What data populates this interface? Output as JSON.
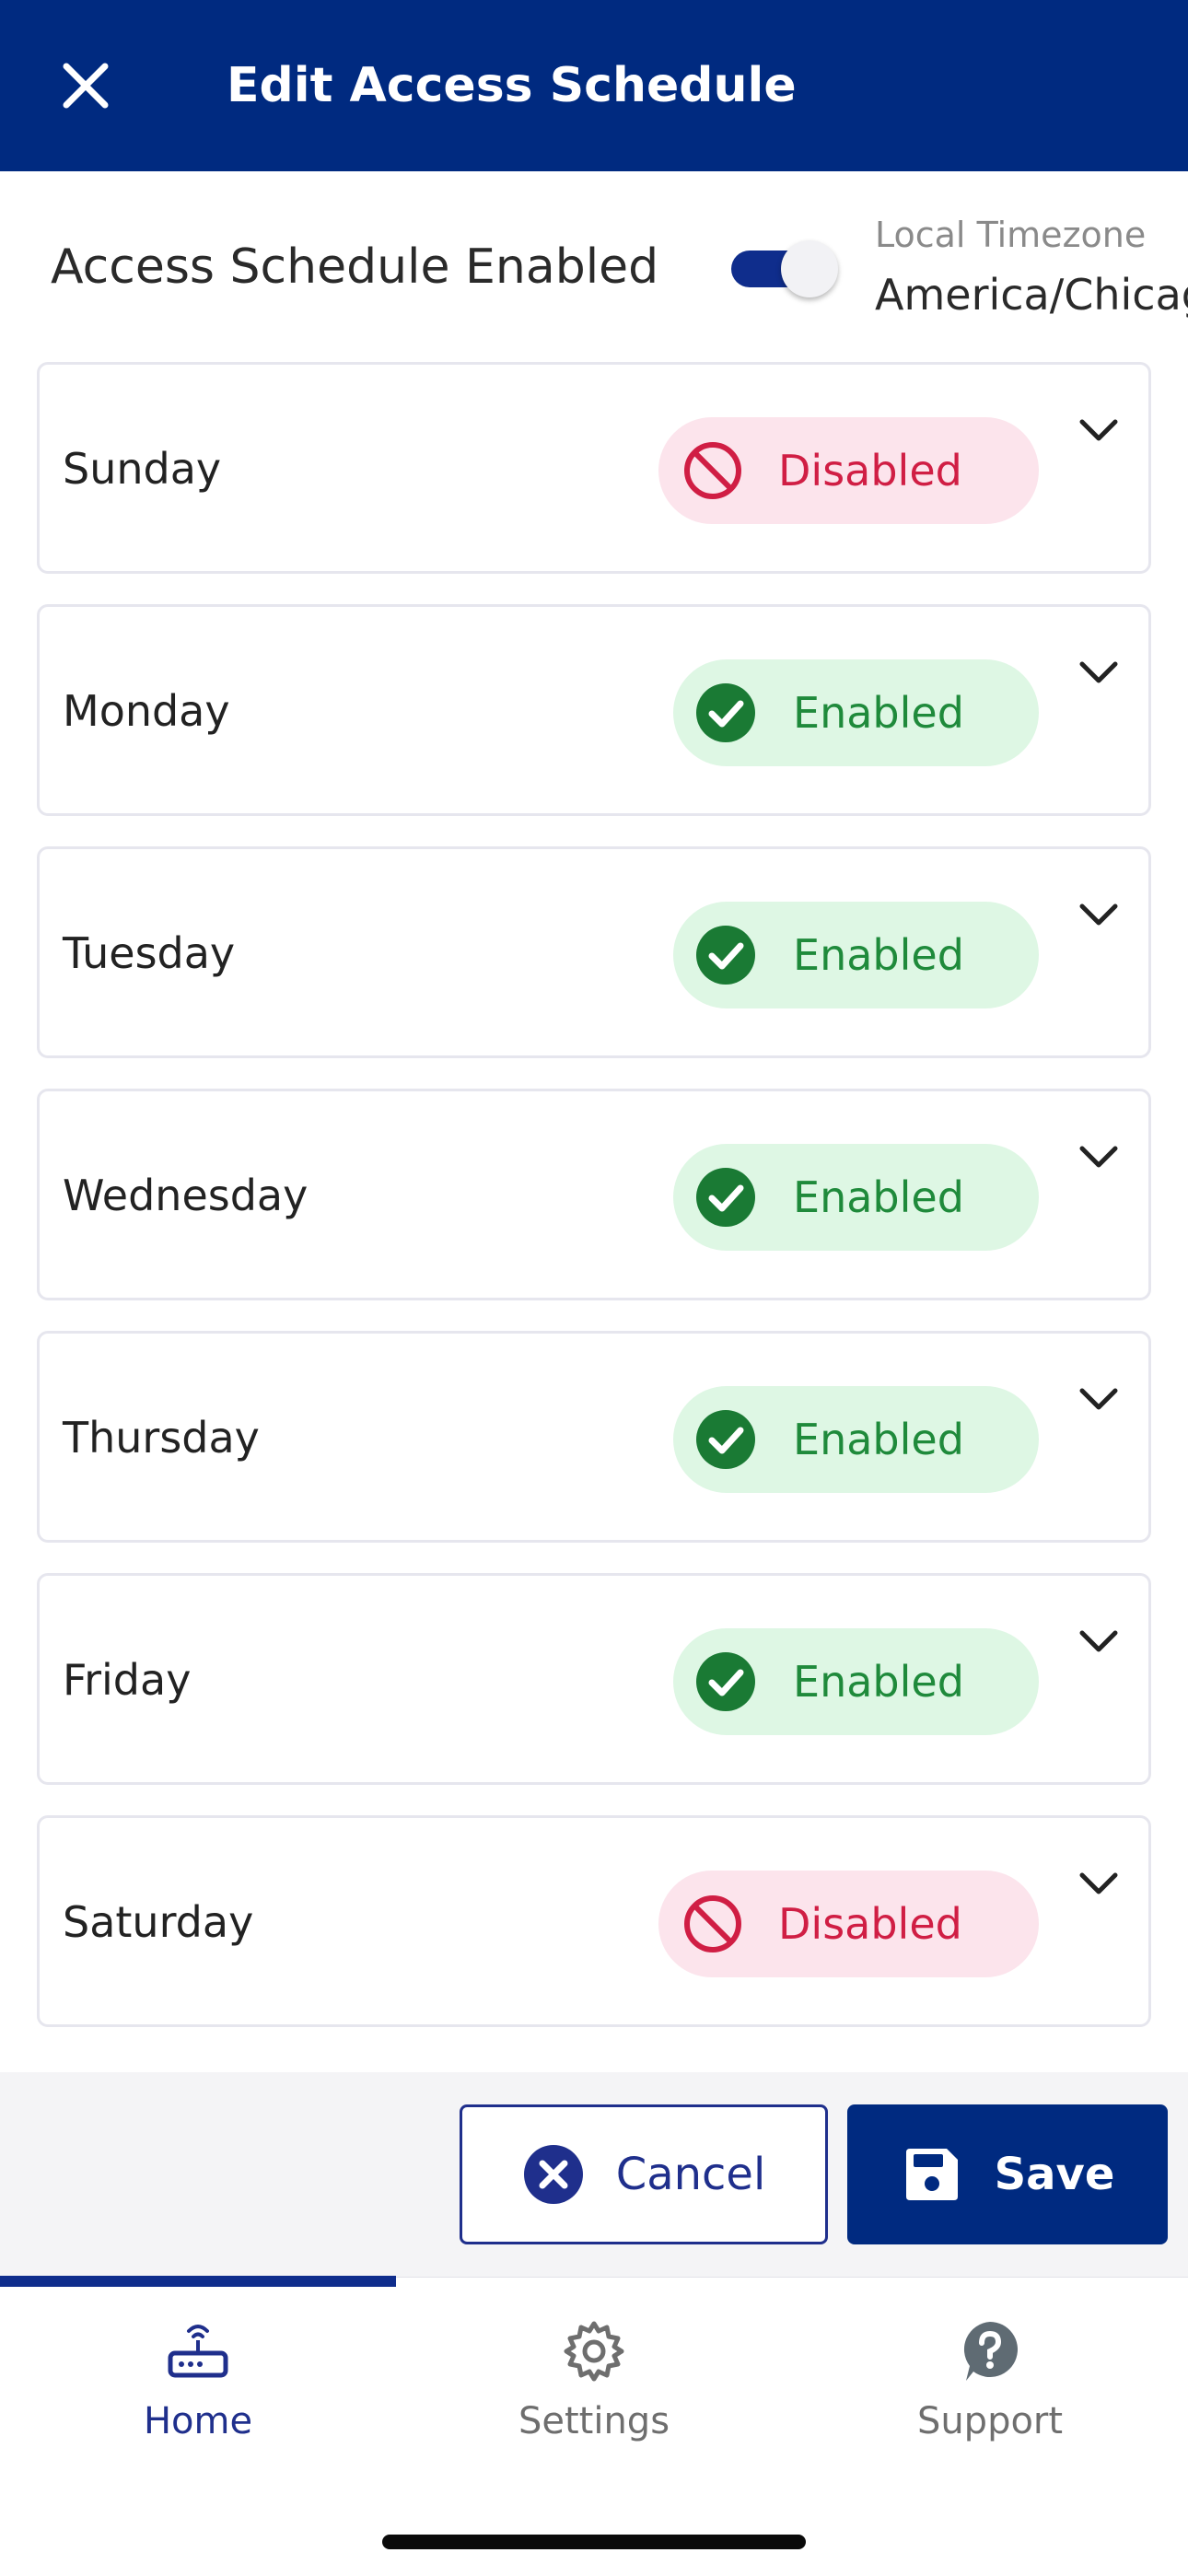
{
  "header": {
    "title": "Edit Access Schedule",
    "close_icon": "close-icon"
  },
  "schedule_toggle": {
    "label": "Access Schedule Enabled",
    "on": true
  },
  "timezone": {
    "label": "Local Timezone",
    "value": "America/Chicago"
  },
  "days": [
    {
      "name": "Sunday",
      "status": "Disabled"
    },
    {
      "name": "Monday",
      "status": "Enabled"
    },
    {
      "name": "Tuesday",
      "status": "Enabled"
    },
    {
      "name": "Wednesday",
      "status": "Enabled"
    },
    {
      "name": "Thursday",
      "status": "Enabled"
    },
    {
      "name": "Friday",
      "status": "Enabled"
    },
    {
      "name": "Saturday",
      "status": "Disabled"
    }
  ],
  "actions": {
    "cancel_label": "Cancel",
    "save_label": "Save"
  },
  "nav": {
    "items": [
      {
        "label": "Home",
        "icon": "router-icon",
        "active": true
      },
      {
        "label": "Settings",
        "icon": "gear-icon",
        "active": false
      },
      {
        "label": "Support",
        "icon": "help-icon",
        "active": false
      }
    ]
  },
  "colors": {
    "primary": "#002a80",
    "enabled_bg": "#def7e4",
    "enabled_fg": "#1f8a3b",
    "disabled_bg": "#fce4ec",
    "disabled_fg": "#d01e44"
  }
}
